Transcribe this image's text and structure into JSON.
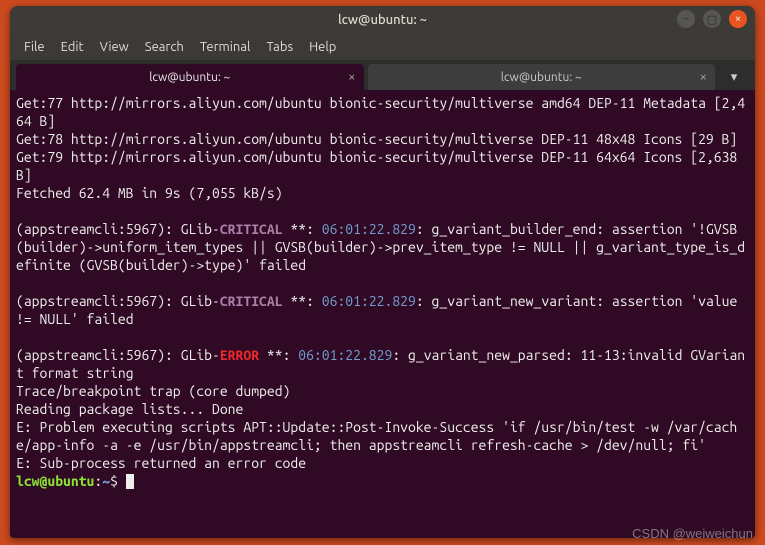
{
  "window": {
    "title": "lcw@ubuntu: ~"
  },
  "menu": {
    "file": "File",
    "edit": "Edit",
    "view": "View",
    "search": "Search",
    "terminal": "Terminal",
    "tabs": "Tabs",
    "help": "Help"
  },
  "tabs": [
    {
      "label": "lcw@ubuntu: ~",
      "active": true
    },
    {
      "label": "lcw@ubuntu: ~",
      "active": false
    }
  ],
  "prompt": {
    "user_host": "lcw@ubuntu",
    "sep": ":",
    "path": "~",
    "sigil": "$ "
  },
  "term": {
    "l1a": "Get:77 http://mirrors.aliyun.com/ubuntu bionic-security/multiverse amd64 DEP-11 Metadata [2,464 B]",
    "l2a": "Get:78 http://mirrors.aliyun.com/ubuntu bionic-security/multiverse DEP-11 48x48 Icons [29 B]",
    "l3a": "Get:79 http://mirrors.aliyun.com/ubuntu bionic-security/multiverse DEP-11 64x64 Icons [2,638 B]",
    "l4": "Fetched 62.4 MB in 9s (7,055 kB/s)",
    "blank": "",
    "c1_a": "(appstreamcli:5967): GLib-",
    "crit": "CRITICAL",
    "star": " **: ",
    "ts": "06:01:22.829",
    "c1_b": ": g_variant_builder_end: assertion '!GVSB(builder)->uniform_item_types || GVSB(builder)->prev_item_type != NULL || g_variant_type_is_definite (GVSB(builder)->type)' failed",
    "c2_b": ": g_variant_new_variant: assertion 'value != NULL' failed",
    "err": "ERROR",
    "c3_b": ": g_variant_new_parsed: 11-13:invalid GVariant format string",
    "trace": "Trace/breakpoint trap (core dumped)",
    "read": "Reading package lists... Done",
    "e1": "E: Problem executing scripts APT::Update::Post-Invoke-Success 'if /usr/bin/test -w /var/cache/app-info -a -e /usr/bin/appstreamcli; then appstreamcli refresh-cache > /dev/null; fi'",
    "e2": "E: Sub-process returned an error code"
  },
  "watermark": "CSDN @weiweichun"
}
